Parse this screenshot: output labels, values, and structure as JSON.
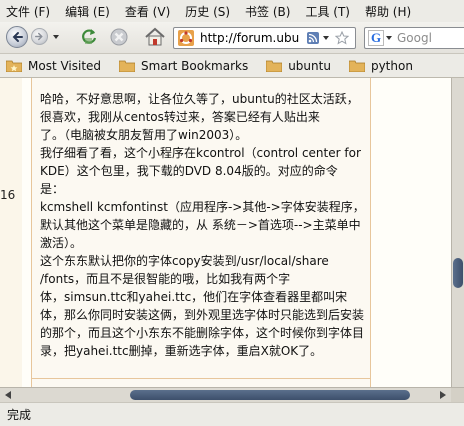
{
  "menubar": {
    "items": [
      {
        "label": "文件 (F)"
      },
      {
        "label": "编辑 (E)"
      },
      {
        "label": "查看 (V)"
      },
      {
        "label": "历史 (S)"
      },
      {
        "label": "书签 (B)"
      },
      {
        "label": "工具 (T)"
      },
      {
        "label": "帮助 (H)"
      }
    ]
  },
  "navbar": {
    "url": "http://forum.ubu",
    "search_placeholder": "Googl",
    "search_engine_letter": "G",
    "icons": [
      "back-arrow-icon",
      "forward-arrow-icon",
      "reload-icon",
      "stop-icon",
      "home-icon",
      "ubuntu-site-icon",
      "rss-feed-icon",
      "bookmark-star-icon",
      "google-icon"
    ]
  },
  "bookmarks": {
    "items": [
      {
        "label": "Most Visited",
        "icon": "bookmark-folder-icon"
      },
      {
        "label": "Smart Bookmarks",
        "icon": "folder-icon"
      },
      {
        "label": "ubuntu",
        "icon": "folder-icon"
      },
      {
        "label": "python",
        "icon": "folder-icon"
      }
    ]
  },
  "post": {
    "number_fragment": "16",
    "lines": [
      "哈哈，不好意思啊，让各位久等了，ubuntu的社区太活跃，",
      "很喜欢，我刚从centos转过来，答案已经有人贴出来",
      "了。（电脑被女朋友暂用了win2003）。",
      "我仔细看了看，这个小程序在kcontrol（control center for",
      "KDE）这个包里，我下载的DVD 8.04版的。对应的命令",
      "是：",
      "kcmshell kcmfontinst（应用程序->其他->字体安装程序，",
      "默认其他这个菜单是隐藏的，从 系统－>首选项-->主菜单中",
      "激活）。",
      "这个东东默认把你的字体copy安装到/usr/local/share",
      "/fonts，而且不是很智能的哦，比如我有两个字",
      "体，simsun.ttc和yahei.ttc，他们在字体查看器里都叫宋",
      "体，那么你同时安装这俩，到外观里选字体时只能选到后安装",
      "的那个，而且这个小东东不能删除字体，这个时候你到字体目",
      "录，把yahei.ttc删掉，重新选字体，重启X就OK了。"
    ]
  },
  "status": {
    "text": "完成"
  },
  "colors": {
    "panel_border": "#e7c69c",
    "scroll_thumb": "#4a5d7a"
  }
}
